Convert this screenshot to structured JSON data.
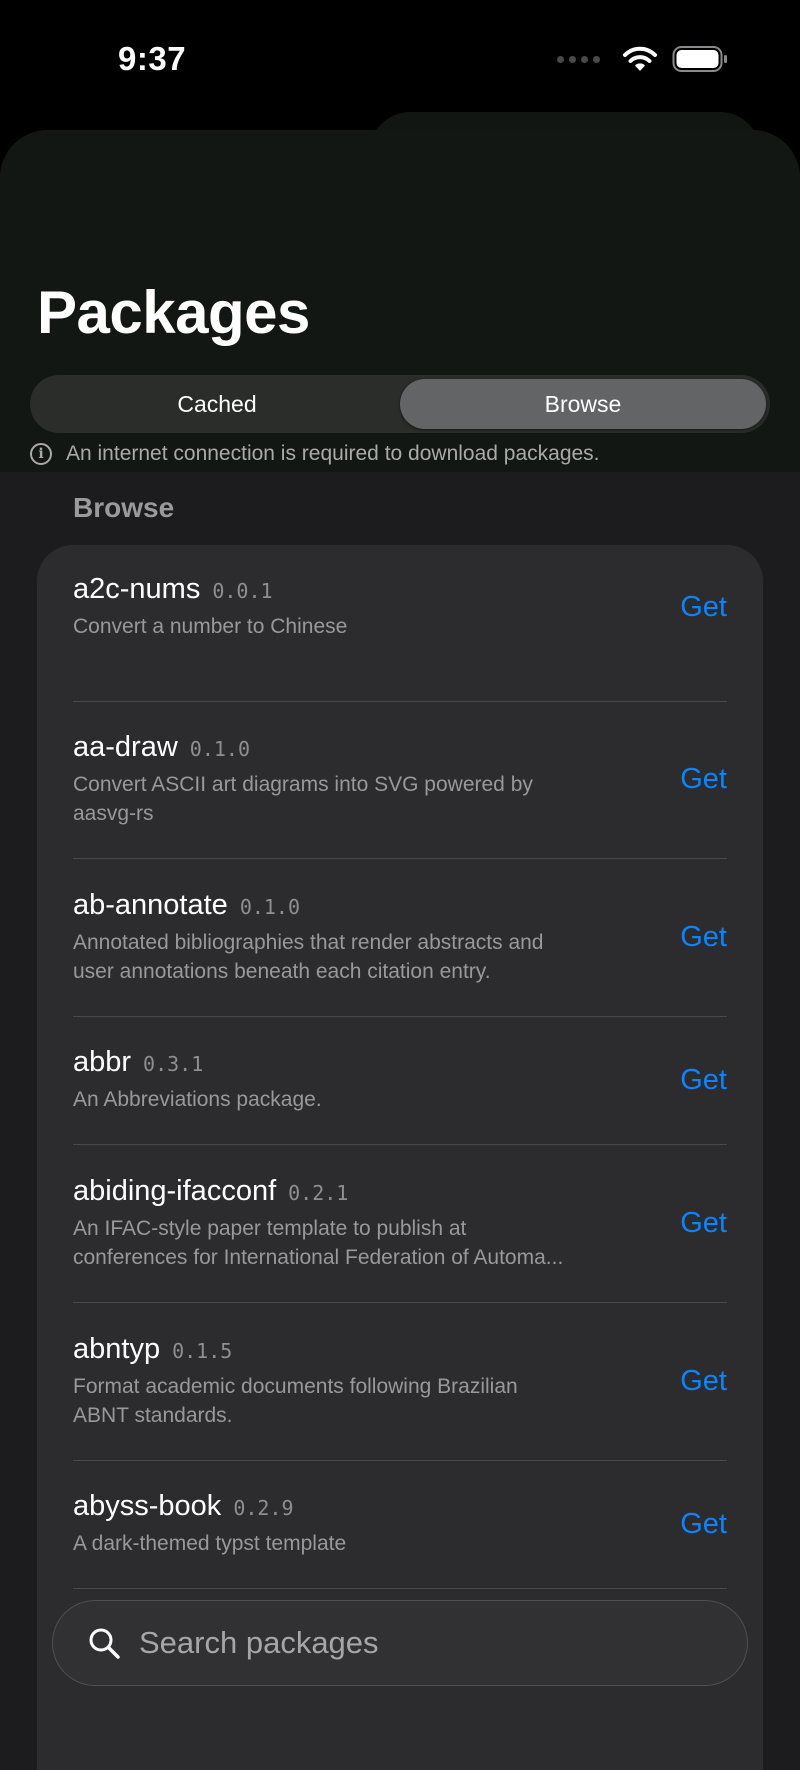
{
  "status_bar": {
    "time": "9:37"
  },
  "header": {
    "title": "Packages",
    "segments": [
      "Cached",
      "Browse"
    ],
    "active_segment": "Browse",
    "notice": "An internet connection is required to download packages."
  },
  "section": {
    "label": "Browse"
  },
  "packages": [
    {
      "name": "a2c-nums",
      "version": "0.0.1",
      "desc_lines": [
        "Convert a number to Chinese"
      ],
      "action": "Get"
    },
    {
      "name": "aa-draw",
      "version": "0.1.0",
      "desc_lines": [
        "Convert ASCII art diagrams into SVG powered by",
        "aasvg-rs"
      ],
      "action": "Get"
    },
    {
      "name": "ab-annotate",
      "version": "0.1.0",
      "desc_lines": [
        "Annotated bibliographies that render abstracts and",
        "user annotations beneath each citation entry."
      ],
      "action": "Get"
    },
    {
      "name": "abbr",
      "version": "0.3.1",
      "desc_lines": [
        "An Abbreviations package."
      ],
      "action": "Get"
    },
    {
      "name": "abiding-ifacconf",
      "version": "0.2.1",
      "desc_lines": [
        "An IFAC-style paper template to publish at",
        "conferences for International Federation of Automa..."
      ],
      "action": "Get"
    },
    {
      "name": "abntyp",
      "version": "0.1.5",
      "desc_lines": [
        "Format academic documents following Brazilian",
        "ABNT standards."
      ],
      "action": "Get"
    },
    {
      "name": "abyss-book",
      "version": "0.2.9",
      "desc_lines": [
        "A dark-themed typst template"
      ],
      "action": "Get"
    }
  ],
  "search": {
    "placeholder": "Search packages"
  },
  "colors": {
    "accent": "#0a84ff",
    "background": "#1c1c1e",
    "card": "#2c2c2e"
  }
}
